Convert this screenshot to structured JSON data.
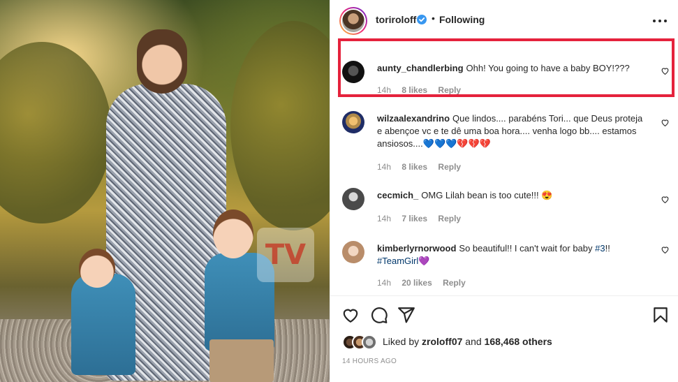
{
  "post": {
    "username": "toriroloff",
    "separator": "•",
    "follow_label": "Following",
    "watermark_text": "TV",
    "comments": [
      {
        "user": "aunty_chandlerbing",
        "text": "Ohh! You going to have a baby BOY!???",
        "time": "14h",
        "likes": "8 likes",
        "reply": "Reply",
        "highlighted": true
      },
      {
        "user": "wilzaalexandrino",
        "text": "Que lindos.... parabéns Tori... que Deus proteja e abençoe vc e te dê uma boa hora.... venha logo bb.... estamos ansiosos....💙💙💙💔💔💔",
        "time": "14h",
        "likes": "8 likes",
        "reply": "Reply"
      },
      {
        "user": "cecmich_",
        "text": "OMG Lilah bean is too cute!!! 😍",
        "time": "14h",
        "likes": "7 likes",
        "reply": "Reply"
      },
      {
        "user": "kimberlyrnorwood",
        "text_pre": "So beautiful!! I can't wait for baby ",
        "tag1": "#3",
        "text_mid": "!! ",
        "tag2": "#TeamGirl",
        "text_post": "💜",
        "time": "14h",
        "likes": "20 likes",
        "reply": "Reply"
      }
    ],
    "liked_by_prefix": "Liked by",
    "liked_by_user": "zroloff07",
    "liked_by_and": "and",
    "liked_by_count": "168,468 others",
    "timestamp": "14 HOURS AGO"
  },
  "colors": {
    "highlight_border": "#e5223c",
    "verified_badge": "#3897f0",
    "hashtag": "#00376b",
    "muted_text": "#8e8e8e"
  },
  "icons": [
    "heart-icon",
    "comment-icon",
    "share-icon",
    "bookmark-icon",
    "more-options-icon",
    "verified-badge-icon"
  ]
}
